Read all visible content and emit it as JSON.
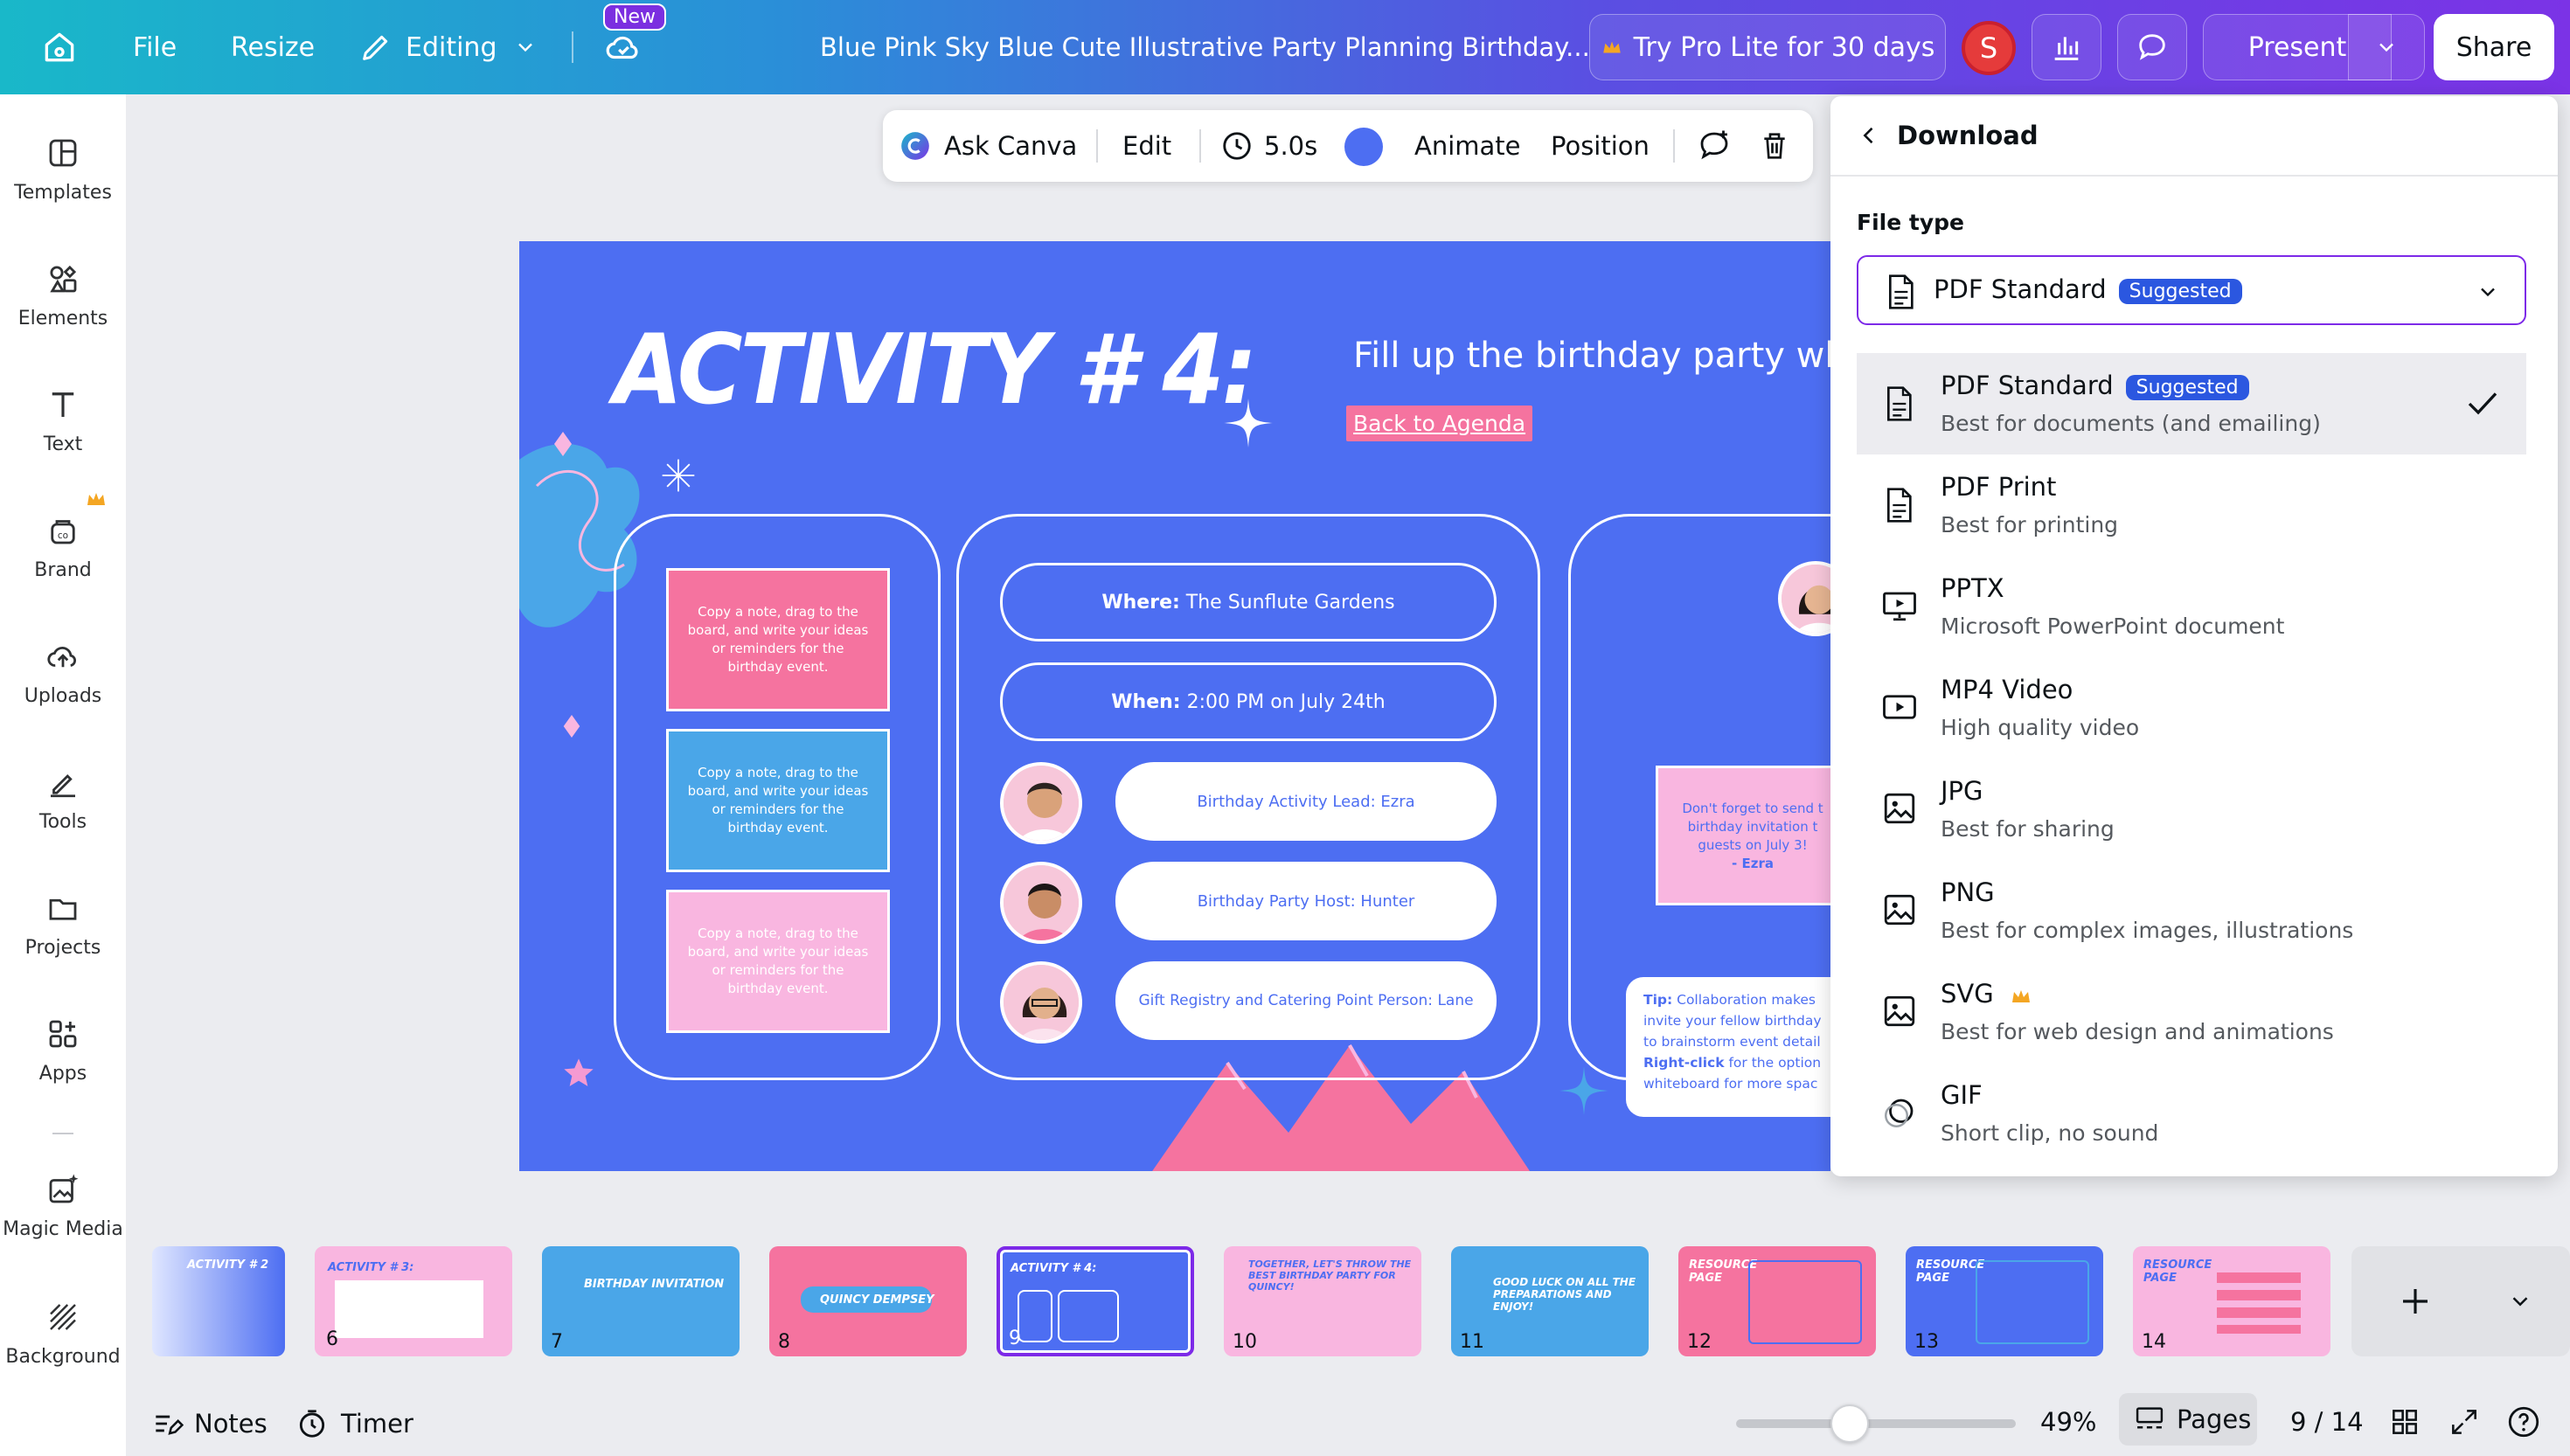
{
  "topbar": {
    "file": "File",
    "resize": "Resize",
    "editing": "Editing",
    "new_badge": "New",
    "doc_title": "Blue Pink Sky Blue Cute Illustrative Party Planning Birthday...",
    "try_pro": "Try Pro Lite for 30 days",
    "avatar_initial": "S",
    "present": "Present",
    "share": "Share"
  },
  "rail": {
    "items": [
      {
        "label": "Templates",
        "icon": "templates-icon"
      },
      {
        "label": "Elements",
        "icon": "elements-icon"
      },
      {
        "label": "Text",
        "icon": "text-icon"
      },
      {
        "label": "Brand",
        "icon": "brand-icon"
      },
      {
        "label": "Uploads",
        "icon": "uploads-icon"
      },
      {
        "label": "Tools",
        "icon": "tools-icon"
      },
      {
        "label": "Projects",
        "icon": "projects-icon"
      },
      {
        "label": "Apps",
        "icon": "apps-icon"
      },
      {
        "label": "Magic Media",
        "icon": "magic-media-icon"
      },
      {
        "label": "Background",
        "icon": "background-icon"
      }
    ]
  },
  "toolbar": {
    "ask_canva": "Ask Canva",
    "edit": "Edit",
    "duration": "5.0s",
    "animate": "Animate",
    "position": "Position"
  },
  "slide": {
    "title": "ACTIVITY # 4:",
    "subtitle": "Fill up the birthday party wh",
    "back_link": "Back to Agenda",
    "notes": [
      "Copy a note, drag to the board, and write your ideas or reminders for the birthday event.",
      "Copy a note, drag to the board, and write your ideas or reminders for the birthday event.",
      "Copy a note, drag to the board, and write your ideas or reminders for the birthday event."
    ],
    "where_label": "Where:",
    "where_value": "The Sunflute Gardens",
    "when_label": "When:",
    "when_value": "2:00 PM on July 24th",
    "roles": [
      "Birthday Activity Lead: Ezra",
      "Birthday Party Host: Hunter",
      "Gift Registry and Catering Point Person: Lane"
    ],
    "reminder_note": "Don't forget to send t birthday invitation t guests on July 3!",
    "reminder_sign": "- Ezra",
    "tip_label": "Tip:",
    "tip_text_1": "Collaboration makes",
    "tip_text_2": "invite your fellow birthday",
    "tip_text_3": "to brainstorm event detail",
    "tip_rightclick": "Right-click",
    "tip_text_4": "for the option",
    "tip_text_5": "whiteboard for more spac"
  },
  "download": {
    "title": "Download",
    "file_type_label": "File type",
    "selected": "PDF Standard",
    "suggested": "Suggested",
    "options": [
      {
        "name": "PDF Standard",
        "desc": "Best for documents (and emailing)",
        "icon": "pdf-icon"
      },
      {
        "name": "PDF Print",
        "desc": "Best for printing",
        "icon": "pdf-icon"
      },
      {
        "name": "PPTX",
        "desc": "Microsoft PowerPoint document",
        "icon": "presentation-icon"
      },
      {
        "name": "MP4 Video",
        "desc": "High quality video",
        "icon": "video-icon"
      },
      {
        "name": "JPG",
        "desc": "Best for sharing",
        "icon": "image-icon"
      },
      {
        "name": "PNG",
        "desc": "Best for complex images, illustrations",
        "icon": "image-icon"
      },
      {
        "name": "SVG",
        "desc": "Best for web design and animations",
        "icon": "image-icon"
      },
      {
        "name": "GIF",
        "desc": "Short clip, no sound",
        "icon": "gif-icon"
      }
    ]
  },
  "thumbnails": [
    {
      "num": "",
      "title": "ACTIVITY # 2"
    },
    {
      "num": "6",
      "title": "ACTIVITY # 3:"
    },
    {
      "num": "7",
      "title": "BIRTHDAY INVITATION"
    },
    {
      "num": "8",
      "title": "QUINCY DEMPSEY"
    },
    {
      "num": "9",
      "title": "ACTIVITY # 4:"
    },
    {
      "num": "10",
      "title": "TOGETHER, LET'S THROW THE BEST BIRTHDAY PARTY FOR QUINCY!"
    },
    {
      "num": "11",
      "title": "GOOD LUCK ON ALL THE PREPARATIONS AND ENJOY!"
    },
    {
      "num": "12",
      "title": "RESOURCE PAGE"
    },
    {
      "num": "13",
      "title": "RESOURCE PAGE"
    },
    {
      "num": "14",
      "title": "RESOURCE PAGE"
    }
  ],
  "bottombar": {
    "notes": "Notes",
    "timer": "Timer",
    "zoom": "49%",
    "pages": "Pages",
    "page_count": "9 / 14"
  },
  "colors": {
    "slide_bg": "#4d6ef2",
    "pink": "#f5739f",
    "sky": "#4aa6e8",
    "light_pink": "#f9b6e0",
    "accent": "#2b57e0",
    "crown": "#f4a623"
  }
}
